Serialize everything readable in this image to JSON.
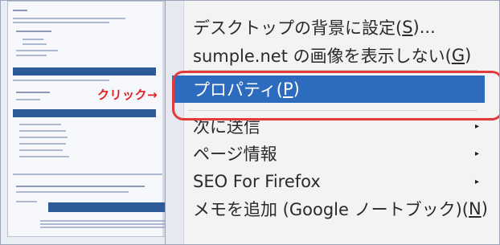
{
  "callout": {
    "label": "クリック→"
  },
  "menu": {
    "items": [
      {
        "label_pre": "デスクトップの背景に設定(",
        "underline": "S",
        "label_post": ")..."
      },
      {
        "label_pre": "sumple.net の画像を表示しない(",
        "underline": "G",
        "label_post": ")"
      },
      {
        "label_pre": "プロパティ(",
        "underline": "P",
        "label_post": ")"
      },
      {
        "label_pre": "次に送信",
        "underline": "",
        "label_post": ""
      },
      {
        "label_pre": "ページ情報",
        "underline": "",
        "label_post": ""
      },
      {
        "label_pre": "SEO For Firefox",
        "underline": "",
        "label_post": ""
      },
      {
        "label_pre": "メモを追加 (Google ノートブック)(",
        "underline": "N",
        "label_post": ")"
      }
    ]
  },
  "colors": {
    "selection": "#2d6bbf",
    "highlight_border": "#e23b3b",
    "callout_text": "#e02020"
  },
  "icons": {
    "submenu_arrow": "▸"
  }
}
